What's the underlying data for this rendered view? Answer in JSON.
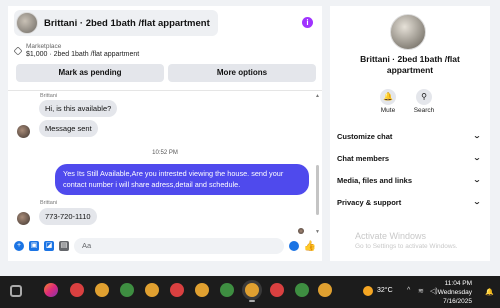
{
  "chat": {
    "title": "Brittani · 2bed 1bath /flat appartment",
    "info_icon": "i",
    "marketplace": {
      "label": "Marketplace",
      "price_title": "$1,000 · 2bed 1bath /flat appartment",
      "mark_pending": "Mark as pending",
      "more_options": "More options"
    },
    "messages": {
      "sender_top": "Brittani",
      "m1": "Hi, is this available?",
      "m2": "Message sent",
      "timestamp": "10:52 PM",
      "outgoing": "Yes Its Still Available,Are you intrested viewing the house. send your contact number i will share adress,detail and schedule.",
      "sender_bottom": "Brittani",
      "m3": "773-720-1110"
    },
    "composer": {
      "placeholder": "Aa"
    }
  },
  "info": {
    "title": "Brittani · 2bed 1bath /flat appartment",
    "actions": {
      "mute": "Mute",
      "search": "Search"
    },
    "sections": [
      "Customize chat",
      "Chat members",
      "Media, files and links",
      "Privacy & support"
    ],
    "watermark_title": "Activate Windows",
    "watermark_sub": "Go to Settings to activate Windows."
  },
  "taskbar": {
    "temperature": "32°C",
    "time": "11:04 PM",
    "day": "Wednesday",
    "date": "7/16/2025"
  },
  "colors": {
    "accent": "#4f4aed",
    "messenger_blue": "#1b74e4",
    "info_purple": "#a033ff"
  }
}
